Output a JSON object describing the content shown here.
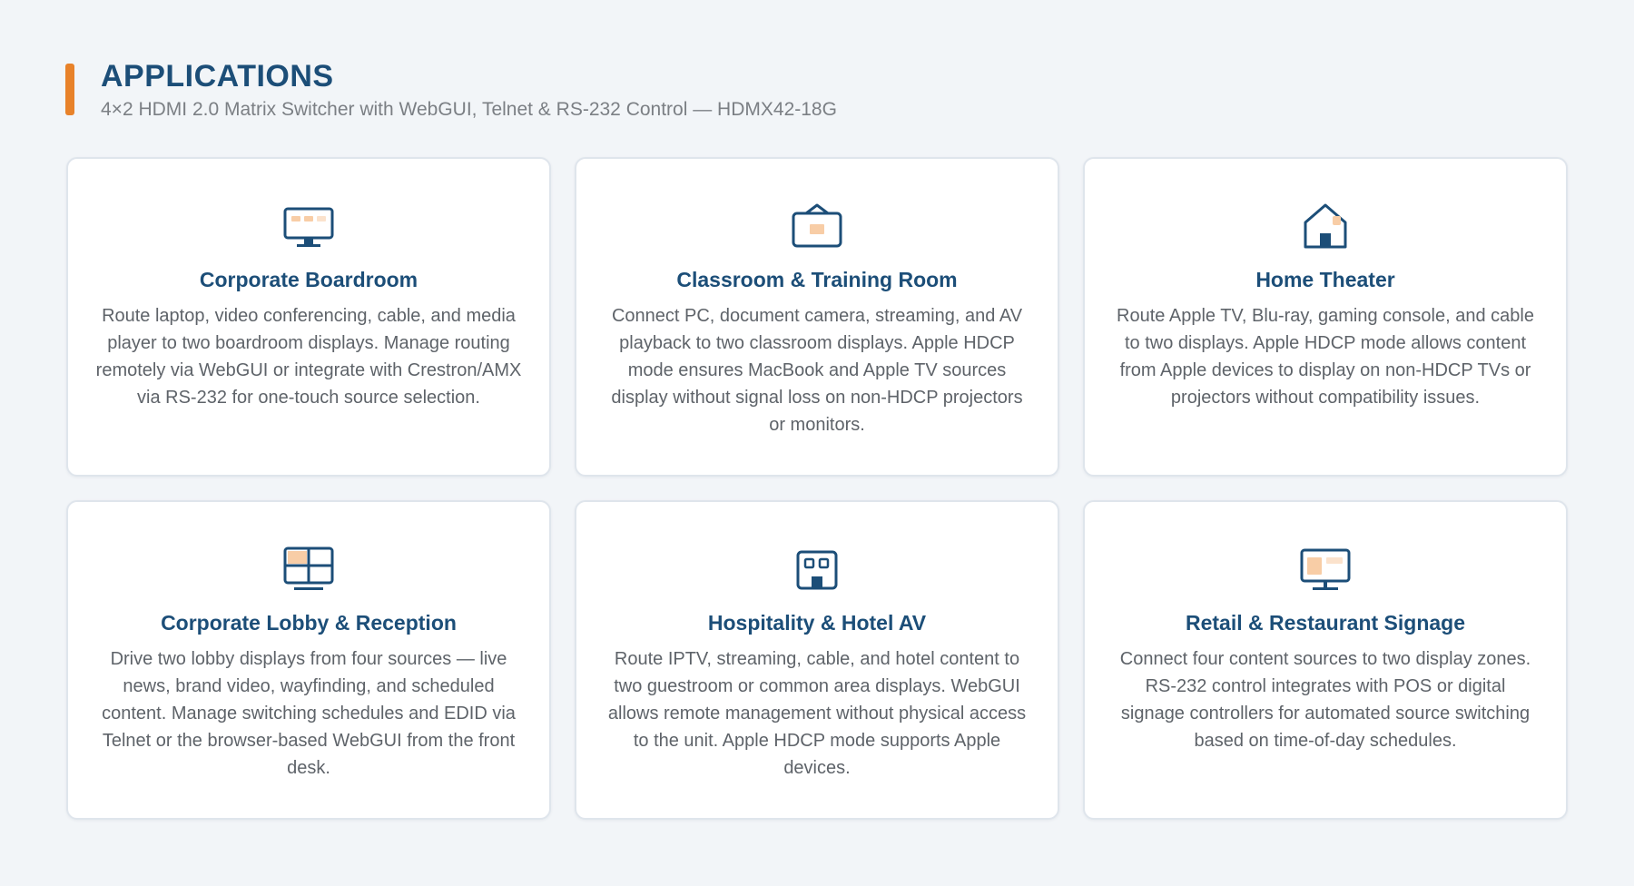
{
  "header": {
    "title": "APPLICATIONS",
    "subtitle": "4×2 HDMI 2.0 Matrix Switcher with WebGUI, Telnet & RS-232 Control — HDMX42-18G"
  },
  "colors": {
    "accent": "#e8822a",
    "primary": "#1c4e78",
    "icon_fill": "#f8cda6"
  },
  "cards": [
    {
      "icon": "monitor-icon",
      "title": "Corporate Boardroom",
      "description": "Route laptop, video conferencing, cable, and media player to two boardroom displays. Manage routing remotely via WebGUI or integrate with Crestron/AMX via RS-232 for one-touch source selection."
    },
    {
      "icon": "projector-screen-icon",
      "title": "Classroom & Training Room",
      "description": "Connect PC, document camera, streaming, and AV playback to two classroom displays. Apple HDCP mode ensures MacBook and Apple TV sources display without signal loss on non-HDCP projectors or monitors."
    },
    {
      "icon": "house-icon",
      "title": "Home Theater",
      "description": "Route Apple TV, Blu-ray, gaming console, and cable to two displays. Apple HDCP mode allows content from Apple devices to display on non-HDCP TVs or projectors without compatibility issues."
    },
    {
      "icon": "video-wall-icon",
      "title": "Corporate Lobby & Reception",
      "description": "Drive two lobby displays from four sources — live news, brand video, wayfinding, and scheduled content. Manage switching schedules and EDID via Telnet or the browser-based WebGUI from the front desk."
    },
    {
      "icon": "hotel-building-icon",
      "title": "Hospitality & Hotel AV",
      "description": "Route IPTV, streaming, cable, and hotel content to two guestroom or common area displays. WebGUI allows remote management without physical access to the unit. Apple HDCP mode supports Apple devices."
    },
    {
      "icon": "signage-display-icon",
      "title": "Retail & Restaurant Signage",
      "description": "Connect four content sources to two display zones. RS-232 control integrates with POS or digital signage controllers for automated source switching based on time-of-day schedules."
    }
  ]
}
